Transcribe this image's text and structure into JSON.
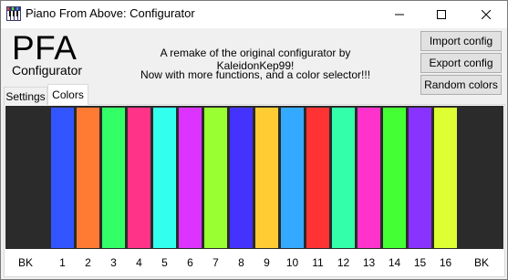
{
  "window": {
    "title": "Piano From Above: Configurator",
    "controls": [
      "minimize",
      "maximize",
      "close"
    ]
  },
  "header": {
    "logo": "PFA",
    "subtitle": "Configurator",
    "message_1": "A remake of the original configurator by KaleidonKep99!",
    "message_2": "Now with more functions, and a color selector!!!"
  },
  "buttons": {
    "import": "Import config",
    "export": "Export config",
    "random": "Random colors"
  },
  "tabs": [
    {
      "label": "Settings",
      "active": false
    },
    {
      "label": "Colors",
      "active": true
    }
  ],
  "colors": {
    "background_key": "#2b2b2b",
    "channels": [
      {
        "label": "1",
        "color": "#3355ff"
      },
      {
        "label": "2",
        "color": "#ff7a33"
      },
      {
        "label": "3",
        "color": "#33ff66"
      },
      {
        "label": "4",
        "color": "#ff3388"
      },
      {
        "label": "5",
        "color": "#33ffee"
      },
      {
        "label": "6",
        "color": "#dd33ff"
      },
      {
        "label": "7",
        "color": "#99ff33"
      },
      {
        "label": "8",
        "color": "#4433ff"
      },
      {
        "label": "9",
        "color": "#ffcc33"
      },
      {
        "label": "10",
        "color": "#33aaff"
      },
      {
        "label": "11",
        "color": "#ff3333"
      },
      {
        "label": "12",
        "color": "#33ffaa"
      },
      {
        "label": "13",
        "color": "#ff33cc"
      },
      {
        "label": "14",
        "color": "#44ff33"
      },
      {
        "label": "15",
        "color": "#8833ff"
      },
      {
        "label": "16",
        "color": "#ddff33"
      }
    ],
    "left_label": "BK",
    "right_label": "BK"
  }
}
